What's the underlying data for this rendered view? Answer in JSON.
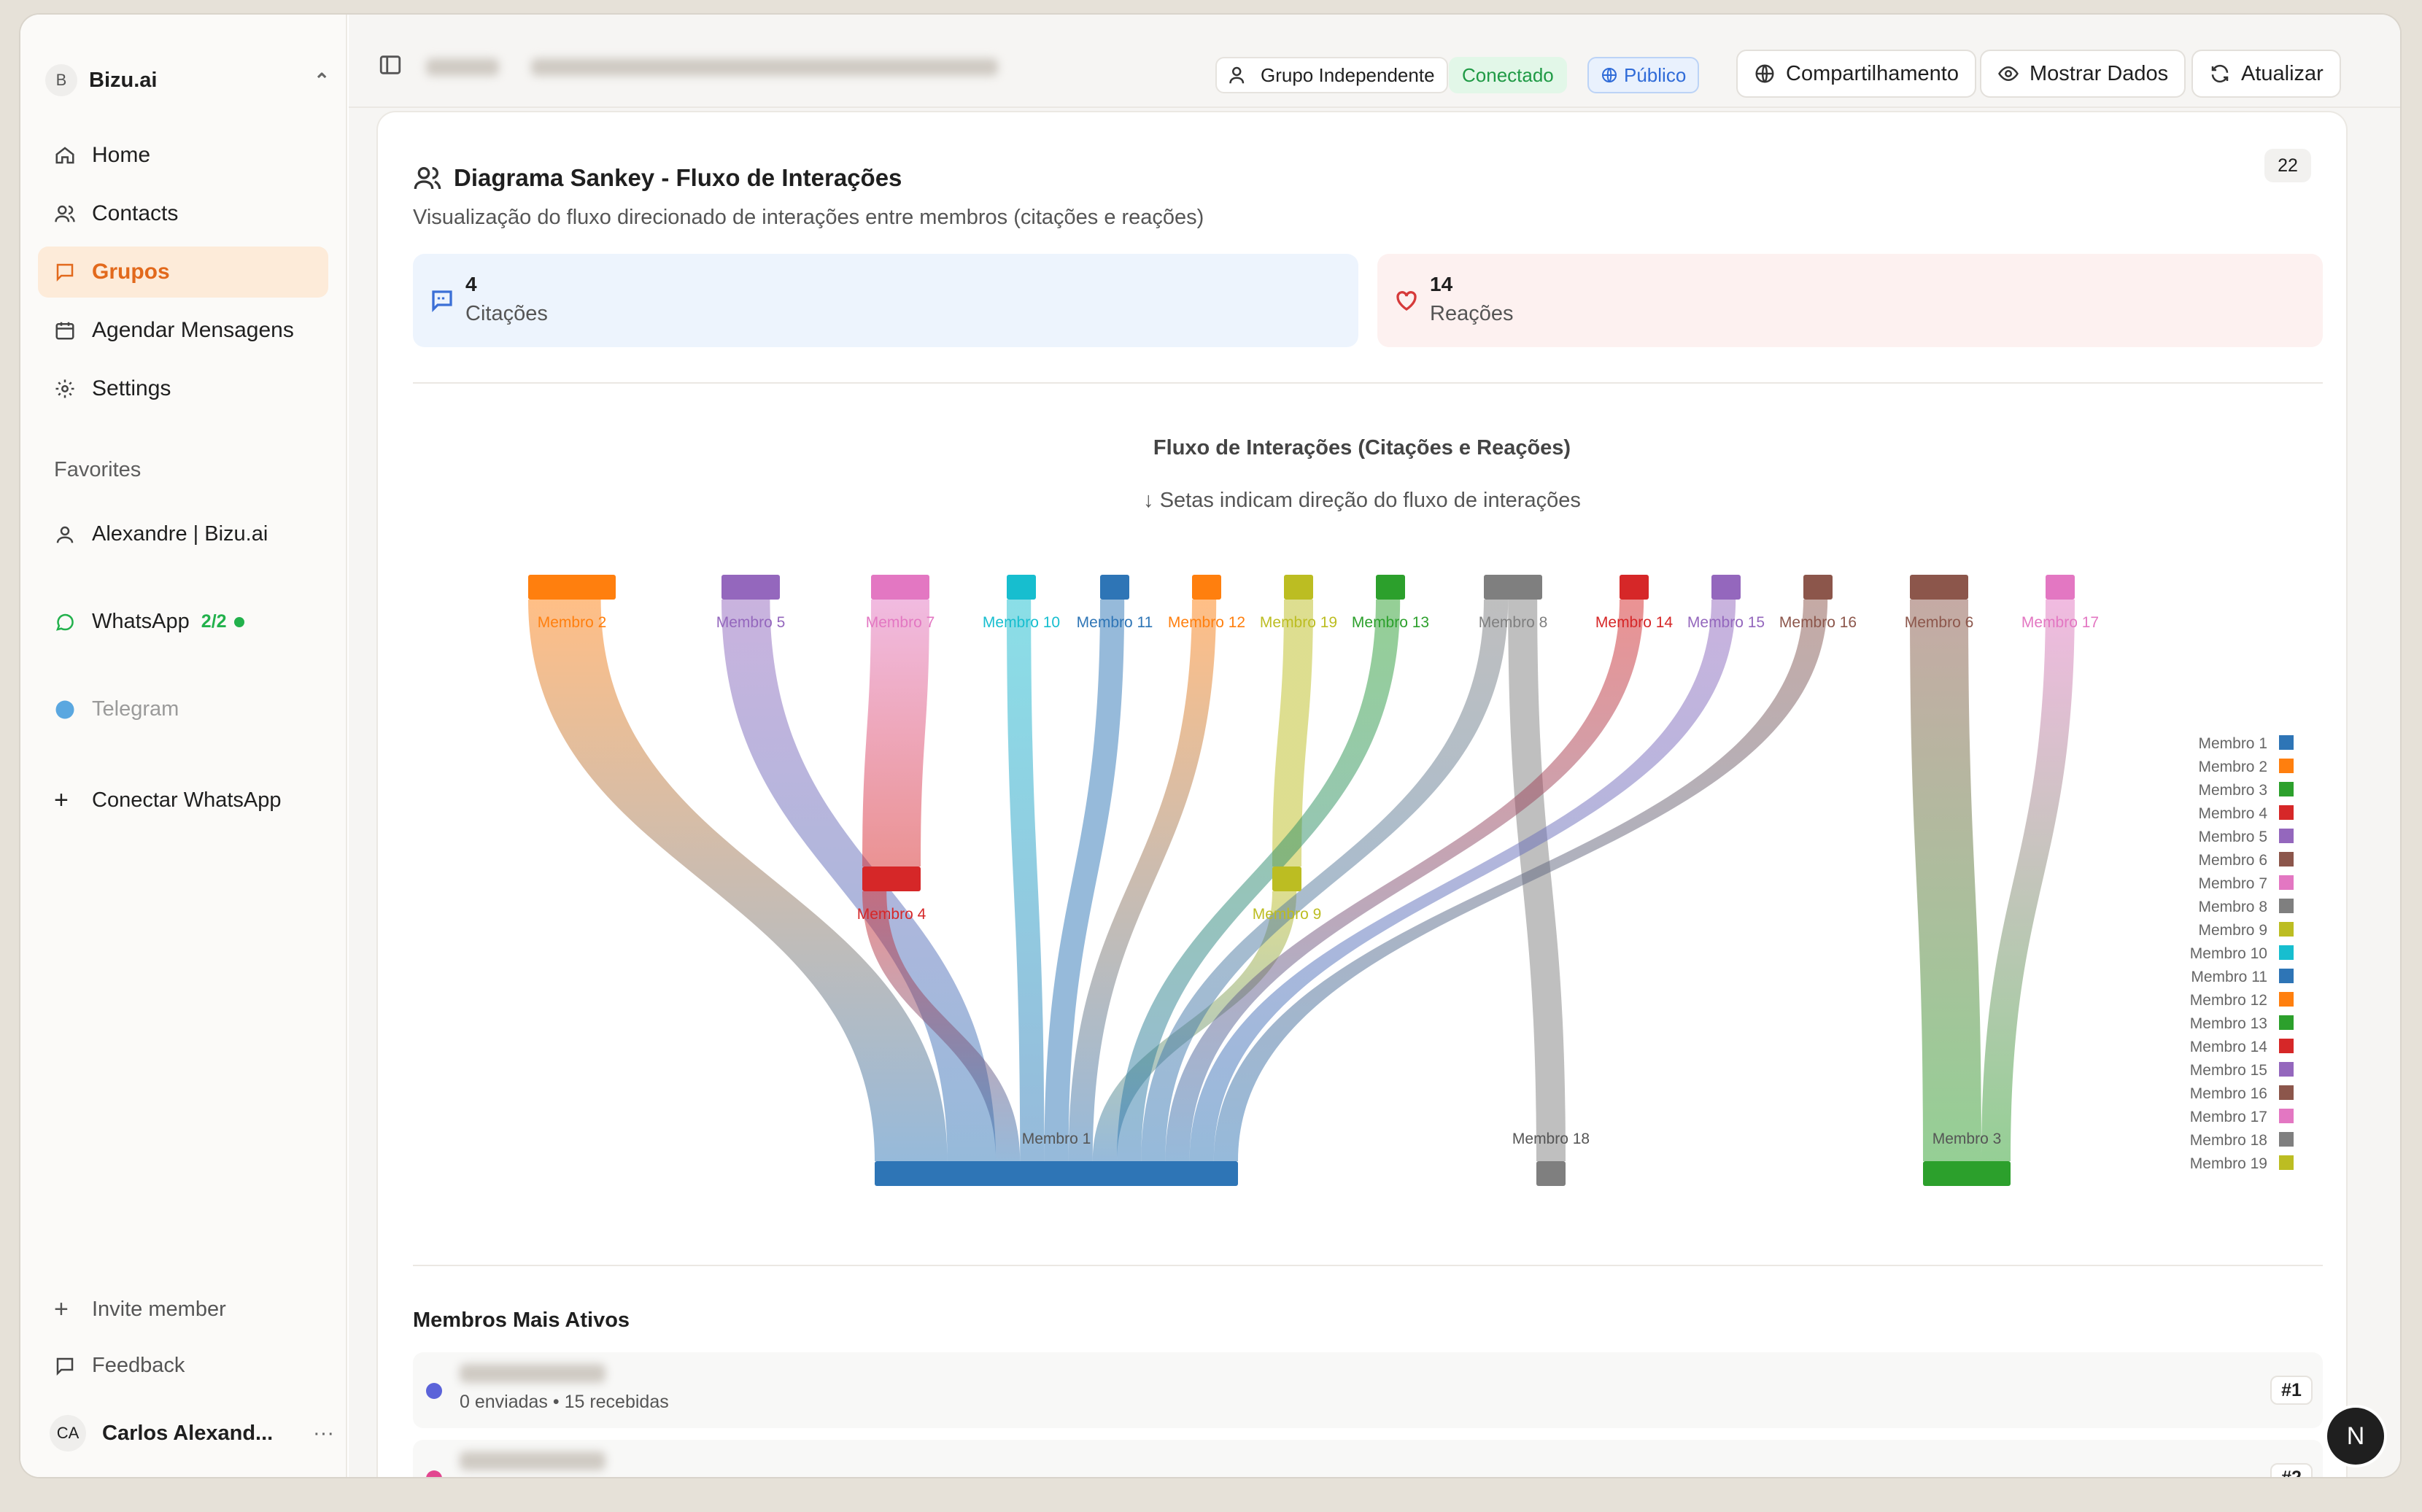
{
  "sidebar": {
    "workspace": {
      "initial": "B",
      "name": "Bizu.ai"
    },
    "nav": [
      {
        "label": "Home",
        "icon": "home-icon"
      },
      {
        "label": "Contacts",
        "icon": "users-icon"
      },
      {
        "label": "Grupos",
        "icon": "message-icon",
        "active": true
      },
      {
        "label": "Agendar Mensagens",
        "icon": "calendar-icon"
      },
      {
        "label": "Settings",
        "icon": "gear-icon"
      }
    ],
    "favorites_title": "Favorites",
    "favorite": "Alexandre | Bizu.ai",
    "whatsapp": {
      "label": "WhatsApp",
      "count": "2/2"
    },
    "telegram": "Telegram",
    "connect": "Conectar WhatsApp",
    "invite": "Invite member",
    "feedback": "Feedback",
    "user": {
      "initials": "CA",
      "name": "Carlos Alexand...",
      "more": "···"
    }
  },
  "topbar": {
    "group_type": "Grupo Independente",
    "status": "Conectado",
    "visibility": "Público",
    "share": "Compartilhamento",
    "show_data": "Mostrar Dados",
    "refresh": "Atualizar"
  },
  "card": {
    "title": "Diagrama Sankey - Fluxo de Interações",
    "subtitle": "Visualização do fluxo direcionado de interações entre membros (citações e reações)",
    "count": "22",
    "citations": {
      "value": "4",
      "label": "Citações"
    },
    "reactions": {
      "value": "14",
      "label": "Reações"
    },
    "chart_title": "Fluxo de Interações (Citações e Reações)",
    "chart_subtitle": "↓ Setas indicam direção do fluxo de interações",
    "members_title": "Membros Mais Ativos",
    "members": [
      {
        "stats": "0 enviadas • 15 recebidas",
        "rank": "#1",
        "color": "#5b63d9"
      },
      {
        "stats": "",
        "rank": "#2",
        "color": "#e2468f"
      }
    ]
  },
  "fab": "N",
  "chart_data": {
    "type": "sankey",
    "title": "Fluxo de Interações (Citações e Reações)",
    "legend_position": "right",
    "nodes": [
      {
        "name": "Membro 1",
        "color": "#2e75b6"
      },
      {
        "name": "Membro 2",
        "color": "#ff7f0e"
      },
      {
        "name": "Membro 3",
        "color": "#2ca02c"
      },
      {
        "name": "Membro 4",
        "color": "#d62728"
      },
      {
        "name": "Membro 5",
        "color": "#9467bd"
      },
      {
        "name": "Membro 6",
        "color": "#8c564b"
      },
      {
        "name": "Membro 7",
        "color": "#e377c2"
      },
      {
        "name": "Membro 8",
        "color": "#7f7f7f"
      },
      {
        "name": "Membro 9",
        "color": "#bcbd22"
      },
      {
        "name": "Membro 10",
        "color": "#17becf"
      },
      {
        "name": "Membro 11",
        "color": "#2e75b6"
      },
      {
        "name": "Membro 12",
        "color": "#ff7f0e"
      },
      {
        "name": "Membro 13",
        "color": "#2ca02c"
      },
      {
        "name": "Membro 14",
        "color": "#d62728"
      },
      {
        "name": "Membro 15",
        "color": "#9467bd"
      },
      {
        "name": "Membro 16",
        "color": "#8c564b"
      },
      {
        "name": "Membro 17",
        "color": "#e377c2"
      },
      {
        "name": "Membro 18",
        "color": "#7f7f7f"
      },
      {
        "name": "Membro 19",
        "color": "#bcbd22"
      }
    ],
    "links": [
      {
        "source": "Membro 2",
        "target": "Membro 1",
        "value": 3
      },
      {
        "source": "Membro 5",
        "target": "Membro 1",
        "value": 2
      },
      {
        "source": "Membro 7",
        "target": "Membro 4",
        "value": 2
      },
      {
        "source": "Membro 4",
        "target": "Membro 1",
        "value": 1
      },
      {
        "source": "Membro 10",
        "target": "Membro 1",
        "value": 1
      },
      {
        "source": "Membro 11",
        "target": "Membro 1",
        "value": 1
      },
      {
        "source": "Membro 12",
        "target": "Membro 1",
        "value": 1
      },
      {
        "source": "Membro 19",
        "target": "Membro 9",
        "value": 1
      },
      {
        "source": "Membro 9",
        "target": "Membro 1",
        "value": 1
      },
      {
        "source": "Membro 13",
        "target": "Membro 1",
        "value": 1
      },
      {
        "source": "Membro 8",
        "target": "Membro 1",
        "value": 1
      },
      {
        "source": "Membro 8",
        "target": "Membro 18",
        "value": 1
      },
      {
        "source": "Membro 14",
        "target": "Membro 1",
        "value": 1
      },
      {
        "source": "Membro 15",
        "target": "Membro 1",
        "value": 1
      },
      {
        "source": "Membro 16",
        "target": "Membro 1",
        "value": 1
      },
      {
        "source": "Membro 6",
        "target": "Membro 3",
        "value": 2
      },
      {
        "source": "Membro 17",
        "target": "Membro 3",
        "value": 1
      }
    ]
  }
}
